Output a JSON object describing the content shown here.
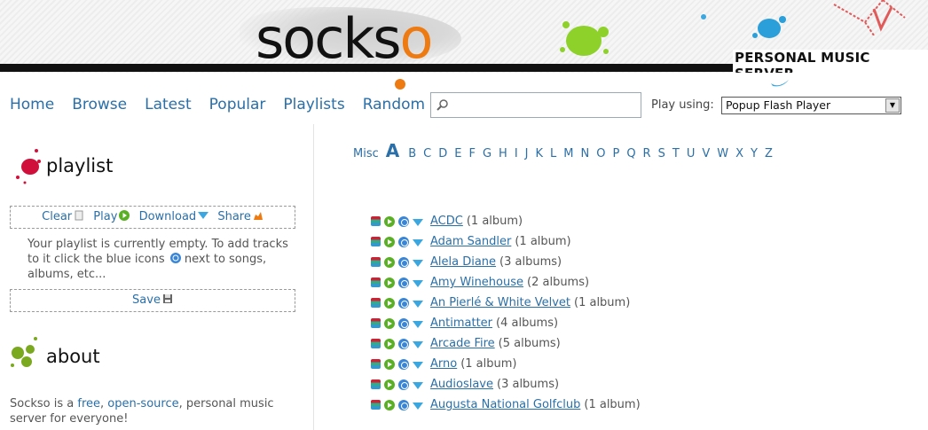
{
  "header": {
    "logo": {
      "part1": "sock",
      "part2": "s",
      "part3": "o"
    },
    "tagline": "PERSONAL MUSIC SERVER"
  },
  "nav": {
    "items": [
      "Home",
      "Browse",
      "Latest",
      "Popular",
      "Playlists",
      "Random"
    ]
  },
  "search": {
    "value": "",
    "placeholder": ""
  },
  "player": {
    "label": "Play using:",
    "selected": "Popup Flash Player"
  },
  "playlist": {
    "title": "playlist",
    "actions": {
      "clear": "Clear",
      "play": "Play",
      "download": "Download",
      "share": "Share"
    },
    "empty_text": "Your playlist is currently empty. To add tracks to it click the blue icons",
    "empty_text_after": "next to songs, albums, etc...",
    "save": "Save"
  },
  "about": {
    "title": "about",
    "text_start": "Sockso is a",
    "link_free": "free",
    "sep": ",",
    "link_open": "open-source",
    "text_end": ", personal music server for everyone!"
  },
  "letters": {
    "misc": "Misc",
    "active": "A",
    "items": [
      "B",
      "C",
      "D",
      "E",
      "F",
      "G",
      "H",
      "I",
      "J",
      "K",
      "L",
      "M",
      "N",
      "O",
      "P",
      "Q",
      "R",
      "S",
      "T",
      "U",
      "V",
      "W",
      "X",
      "Y",
      "Z"
    ]
  },
  "artists": [
    {
      "name": "ACDC",
      "count": "(1 album)"
    },
    {
      "name": "Adam Sandler",
      "count": "(1 album)"
    },
    {
      "name": "Alela Diane",
      "count": "(3 albums)"
    },
    {
      "name": "Amy Winehouse",
      "count": "(2 albums)"
    },
    {
      "name": "An Pierlé & White Velvet",
      "count": "(1 album)"
    },
    {
      "name": "Antimatter",
      "count": "(4 albums)"
    },
    {
      "name": "Arcade Fire",
      "count": "(5 albums)"
    },
    {
      "name": "Arno",
      "count": "(1 album)"
    },
    {
      "name": "Audioslave",
      "count": "(3 albums)"
    },
    {
      "name": "Augusta National Golfclub",
      "count": "(1 album)"
    }
  ],
  "colors": {
    "link": "#2a6fa8",
    "accent_orange": "#ee7a12",
    "accent_green": "#8dd12a",
    "accent_blue": "#3aa7e0",
    "header_bar": "#111111"
  },
  "icons": {
    "artist_row": [
      "info-icon",
      "play-icon",
      "add-to-playlist-icon",
      "download-icon"
    ],
    "playlist_actions": [
      "clear-icon",
      "play-icon",
      "download-icon",
      "share-icon"
    ],
    "save": "save-icon"
  }
}
